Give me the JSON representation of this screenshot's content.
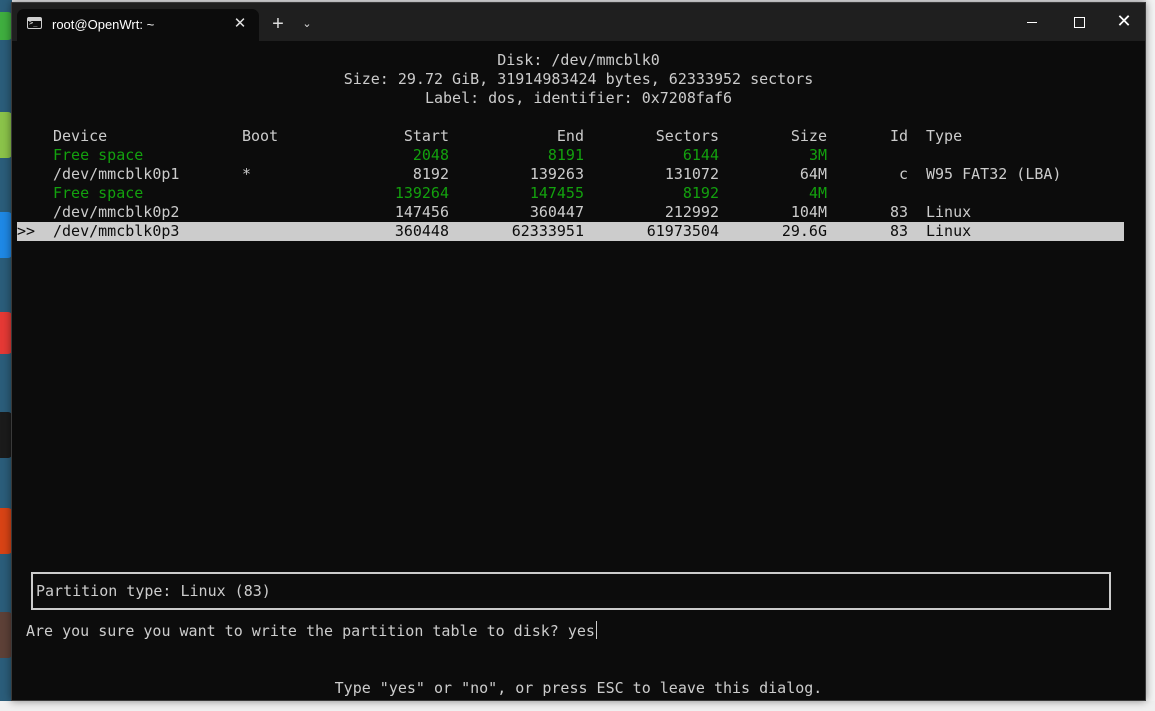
{
  "window": {
    "tab_title": "root@OpenWrt: ~",
    "tab_close": "✕",
    "new_tab": "+",
    "dropdown": "⌄",
    "close": "✕",
    "icons": {
      "tab": "terminal-icon",
      "minimize": "minimize-icon",
      "maximize": "maximize-icon",
      "close": "close-icon"
    }
  },
  "header": {
    "disk": "Disk: /dev/mmcblk0",
    "size": "Size: 29.72 GiB, 31914983424 bytes, 62333952 sectors",
    "label": "Label: dos, identifier: 0x7208faf6"
  },
  "table": {
    "columns": {
      "device": "Device",
      "boot": "Boot",
      "start": "Start",
      "end": "End",
      "sectors": "Sectors",
      "size": "Size",
      "id": "Id",
      "type": "Type"
    },
    "rows": [
      {
        "marker": "",
        "device": "Free space",
        "boot": "",
        "start": "2048",
        "end": "8191",
        "sectors": "6144",
        "size": "3M",
        "id": "",
        "type": ""
      },
      {
        "marker": "",
        "device": "/dev/mmcblk0p1",
        "boot": "*",
        "start": "8192",
        "end": "139263",
        "sectors": "131072",
        "size": "64M",
        "id": "c",
        "type": "W95 FAT32 (LBA)"
      },
      {
        "marker": "",
        "device": "Free space",
        "boot": "",
        "start": "139264",
        "end": "147455",
        "sectors": "8192",
        "size": "4M",
        "id": "",
        "type": ""
      },
      {
        "marker": "",
        "device": "/dev/mmcblk0p2",
        "boot": "",
        "start": "147456",
        "end": "360447",
        "sectors": "212992",
        "size": "104M",
        "id": "83",
        "type": "Linux"
      },
      {
        "marker": ">>",
        "device": "/dev/mmcblk0p3",
        "boot": "",
        "start": "360448",
        "end": "62333951",
        "sectors": "61973504",
        "size": "29.6G",
        "id": "83",
        "type": "Linux"
      }
    ]
  },
  "dialog": {
    "partition_type": "Partition type: Linux (83)",
    "prompt": "Are you sure you want to write the partition table to disk? ",
    "answer": "yes",
    "hint": "Type \"yes\" or \"no\", or press ESC to leave this dialog."
  },
  "colors": {
    "free_space": "#13a10e",
    "text": "#cccccc",
    "background": "#0c0c0c",
    "selected_bg": "#cccccc"
  }
}
